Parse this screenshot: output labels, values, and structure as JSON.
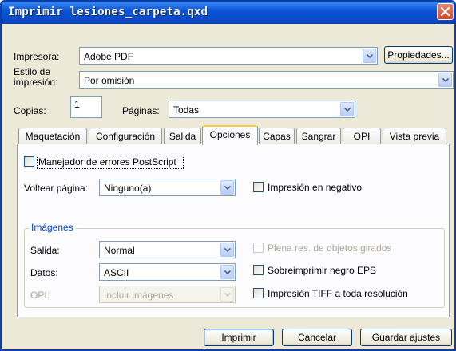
{
  "window": {
    "title": "Imprimir lesiones_carpeta.qxd"
  },
  "printer": {
    "label": "Impresora:",
    "value": "Adobe PDF",
    "properties_button": "Propiedades..."
  },
  "style": {
    "label_line1": "Estilo de",
    "label_line2": "impresión:",
    "value": "Por omisión"
  },
  "copies": {
    "label": "Copias:",
    "value": "1"
  },
  "pages": {
    "label": "Páginas:",
    "value": "Todas"
  },
  "tabs": [
    {
      "label": "Maquetación"
    },
    {
      "label": "Configuración"
    },
    {
      "label": "Salida"
    },
    {
      "label": "Opciones",
      "active": true
    },
    {
      "label": "Capas"
    },
    {
      "label": "Sangrar"
    },
    {
      "label": "OPI"
    },
    {
      "label": "Vista previa"
    }
  ],
  "options": {
    "postscript_error_handler": {
      "label": "Manejador de errores PostScript",
      "checked": false
    },
    "page_flip": {
      "label": "Voltear página:",
      "value": "Ninguno(a)"
    },
    "negative_print": {
      "label": "Impresión en negativo",
      "checked": false
    },
    "images": {
      "group_title": "Imágenes",
      "output": {
        "label": "Salida:",
        "value": "Normal"
      },
      "data": {
        "label": "Datos:",
        "value": "ASCII"
      },
      "opi": {
        "label": "OPI:",
        "value": "Incluir imágenes",
        "disabled": true
      },
      "full_res_rotated": {
        "label": "Plena res. de objetos girados",
        "checked": false,
        "disabled": true
      },
      "overprint_eps_black": {
        "label": "Sobreimprimir negro EPS",
        "checked": false
      },
      "tiff_full_res": {
        "label": "Impresión TIFF a toda resolución",
        "checked": false
      }
    }
  },
  "buttons": {
    "print": "Imprimir",
    "cancel": "Cancelar",
    "save_settings": "Guardar ajustes"
  }
}
